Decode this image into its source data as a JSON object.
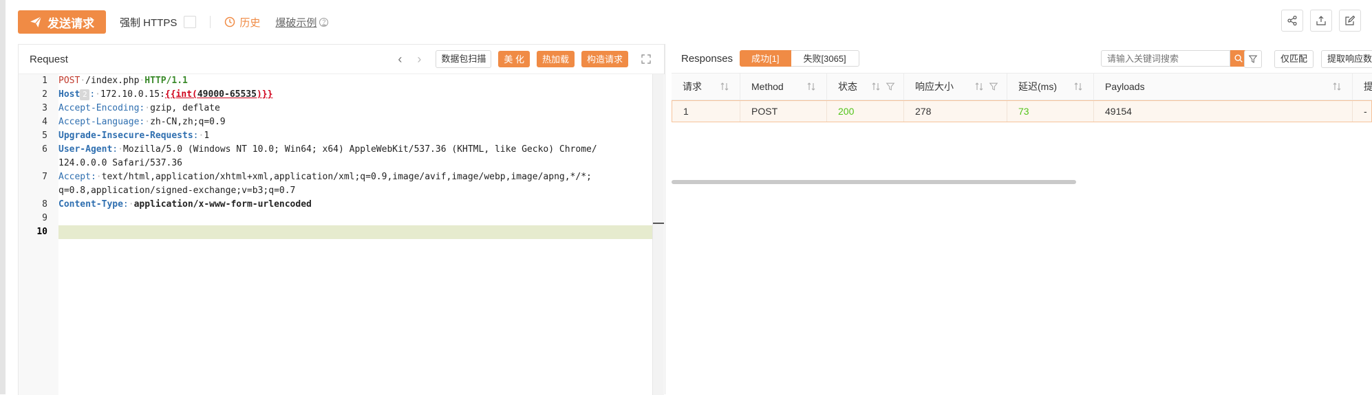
{
  "toolbar": {
    "send_label": "发送请求",
    "https_label": "强制 HTTPS",
    "history_label": "历史",
    "example_label": "爆破示例"
  },
  "top_icons": [
    "share-icon",
    "export-icon",
    "edit-icon"
  ],
  "request": {
    "title": "Request",
    "buttons": {
      "scan": "数据包扫描",
      "beautify": "美 化",
      "hotload": "热加载",
      "construct": "构造请求"
    },
    "line_numbers": [
      "1",
      "2",
      "3",
      "4",
      "5",
      "6",
      "",
      "7",
      "",
      "8",
      "9",
      "10"
    ],
    "lines": {
      "l1": {
        "method": "POST",
        "path": "/index.php",
        "version": "HTTP/1.1"
      },
      "l2": {
        "key": "Host",
        "badge": "2",
        "host": "172.10.0.15:",
        "tpl_open": "{{int(",
        "tpl_range": "49000-65535",
        "tpl_close": ")}}"
      },
      "l3": {
        "key": "Accept-Encoding",
        "value": "gzip, deflate"
      },
      "l4": {
        "key": "Accept-Language",
        "value": "zh-CN,zh;q=0.9"
      },
      "l5": {
        "key": "Upgrade-Insecure-Requests",
        "value": "1"
      },
      "l6": {
        "key": "User-Agent",
        "value": "Mozilla/5.0 (Windows NT 10.0; Win64; x64) AppleWebKit/537.36 (KHTML, like Gecko) Chrome/",
        "cont": "124.0.0.0 Safari/537.36"
      },
      "l7": {
        "key": "Accept",
        "value": "text/html,application/xhtml+xml,application/xml;q=0.9,image/avif,image/webp,image/apng,*/*;",
        "cont": "q=0.8,application/signed-exchange;v=b3;q=0.7"
      },
      "l8": {
        "key": "Content-Type",
        "value": "application/x-www-form-urlencoded"
      }
    },
    "active_line": "10"
  },
  "responses": {
    "title": "Responses",
    "tab_success": "成功[1]",
    "tab_fail": "失败[3065]",
    "search_placeholder": "请输入关键词搜索",
    "btn_exact": "仅匹配",
    "btn_extract": "提取响应数",
    "columns": {
      "req": "请求",
      "method": "Method",
      "status": "状态",
      "size": "响应大小",
      "delay": "延迟(ms)",
      "payloads": "Payloads",
      "extra": "提"
    },
    "rows": [
      {
        "req": "1",
        "method": "POST",
        "status": "200",
        "size": "278",
        "delay": "73",
        "payloads": "49154",
        "extra": "-"
      }
    ]
  },
  "colors": {
    "accent": "#f08b45",
    "success": "#52c41a",
    "highlight_line": "#e6ebce"
  }
}
